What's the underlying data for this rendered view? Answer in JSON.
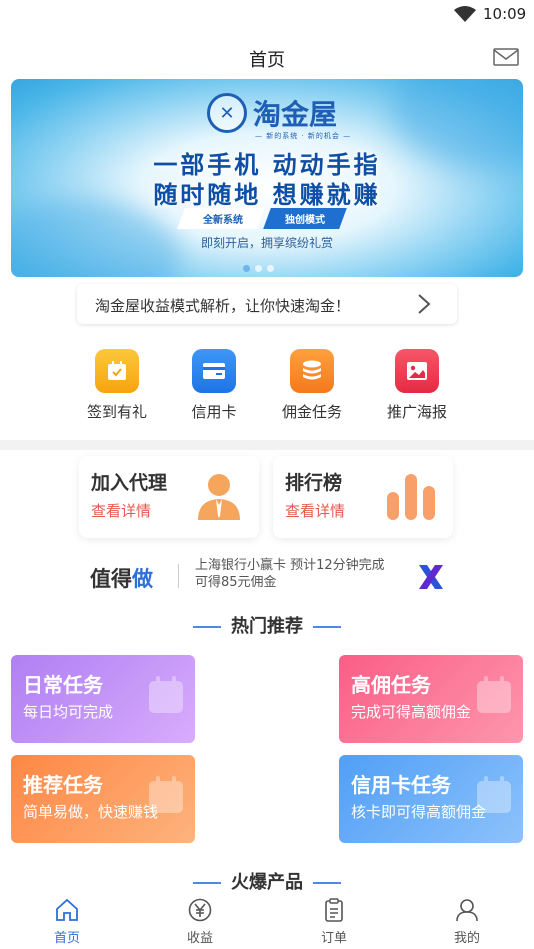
{
  "status": {
    "time": "10:09"
  },
  "header": {
    "title": "首页"
  },
  "banner": {
    "logo_text": "淘金屋",
    "logo_sub": "— 新的系统 · 新的机会 —",
    "line1": "一部手机  动动手指",
    "line2": "随时随地  想赚就赚",
    "tag_a": "全新系统",
    "tag_b": "独创模式",
    "subline": "即刻开启，拥享缤纷礼赏",
    "dot_count": 3,
    "active_dot": 0
  },
  "notice": {
    "text": "淘金屋收益模式解析，让你快速淘金！"
  },
  "quick": [
    {
      "label": "签到有礼",
      "icon": "calendar-icon",
      "color": "#f8b21c"
    },
    {
      "label": "信用卡",
      "icon": "credit-card-icon",
      "color": "#2c86f0"
    },
    {
      "label": "佣金任务",
      "icon": "coins-icon",
      "color": "#f5862a"
    },
    {
      "label": "推广海报",
      "icon": "poster-icon",
      "color": "#ef4155"
    }
  ],
  "cards": [
    {
      "title": "加入代理",
      "sub": "查看详情",
      "icon": "agent-icon"
    },
    {
      "title": "排行榜",
      "sub": "查看详情",
      "icon": "bar-chart-icon"
    }
  ],
  "zdz": {
    "brand_a": "值得",
    "brand_b": "做",
    "info": "上海银行小赢卡 预计12分钟完成 可得85元佣金"
  },
  "sections": {
    "hot": "热门推荐",
    "products": "火爆产品"
  },
  "tasks": [
    {
      "title": "日常任务",
      "sub": "每日均可完成",
      "grad": [
        "#b788f5",
        "#d2a6fb"
      ]
    },
    {
      "title": "高佣任务",
      "sub": "完成可得高额佣金",
      "grad": [
        "#fb6a8e",
        "#fe91a9"
      ]
    },
    {
      "title": "推荐任务",
      "sub": "简单易做，快速赚钱",
      "grad": [
        "#fe8e4d",
        "#fdb07a"
      ]
    },
    {
      "title": "信用卡任务",
      "sub": "核卡即可得高额佣金",
      "grad": [
        "#5aa6f7",
        "#85bdfa"
      ]
    }
  ],
  "tabbar": [
    {
      "label": "首页",
      "icon": "home-icon",
      "active": true
    },
    {
      "label": "收益",
      "icon": "yen-icon",
      "active": false
    },
    {
      "label": "订单",
      "icon": "order-icon",
      "active": false
    },
    {
      "label": "我的",
      "icon": "profile-icon",
      "active": false
    }
  ]
}
